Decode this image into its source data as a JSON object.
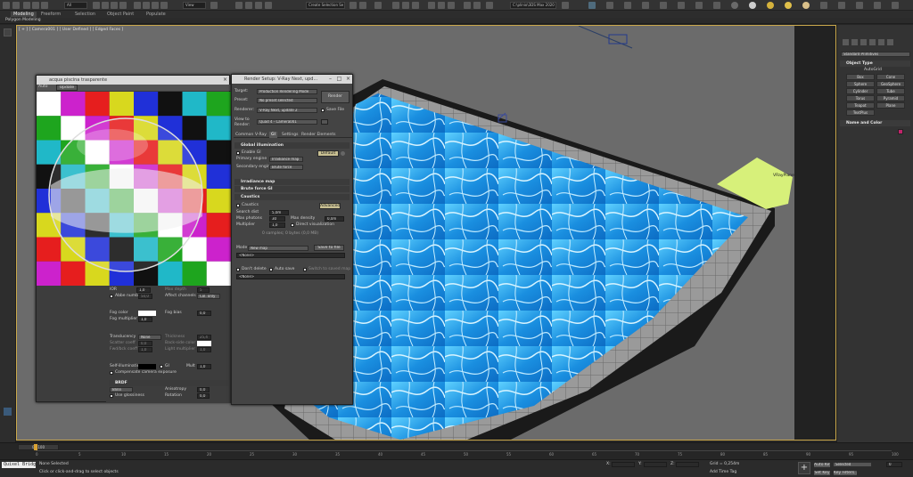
{
  "toolbar": {
    "selection_filter": "All",
    "view_dropdown": "View",
    "create_selection_set": "Create Selection Se",
    "workspace_path": "C:\\plinio\\3DS Max 2020"
  },
  "ribbon": {
    "tabs": [
      "Modeling",
      "Freeform",
      "Selection",
      "Object Paint",
      "Populate"
    ],
    "sub_label": "Polygon Modeling"
  },
  "viewport": {
    "label": "[ + ] [ Camera001 ] [ User Defined ] [ Edged Faces ]",
    "object_label": "VRayPlane"
  },
  "material_window": {
    "title": "acqua piscina trasparente",
    "auto_label": "Auto",
    "update_label": "Update",
    "ior_label": "IOR",
    "ior_value": "1,0",
    "max_depth_label": "Max depth",
    "max_depth_value": "5",
    "abbe_label": "Abbe number",
    "abbe_value": "50,0",
    "affect_channels_label": "Affect channels",
    "affect_channels_value": "Col. only",
    "fog_color_label": "Fog color",
    "fog_bias_label": "Fog bias",
    "fog_bias_value": "0,0",
    "fog_multiplier_label": "Fog multiplier",
    "fog_multiplier_value": "1,0",
    "translucency_label": "Translucency",
    "translucency_value": "None",
    "thickness_label": "Thickness",
    "thickness_value": "25,4",
    "back_side_color_label": "Back-side color",
    "scatter_coeff_label": "Scatter coeff",
    "scatter_coeff_value": "0,0",
    "fwd_bwd_coeff_label": "Fwd/bck coeff",
    "fwd_bwd_coeff_value": "1,0",
    "light_multiplier_label": "Light multiplier",
    "light_multiplier_value": "1,0",
    "self_illum_label": "Self-illumination",
    "gi_label": "GI",
    "mult_label": "Mult",
    "mult_value": "1,0",
    "compensate_label": "Compensate camera exposure",
    "brdf_label": "BRDF",
    "brdf_type": "Blinn",
    "anisotropy_label": "Anisotropy",
    "anisotropy_value": "0,0",
    "use_glossiness_label": "Use glossiness",
    "rotation_label": "Rotation",
    "rotation_value": "0,0"
  },
  "render_setup": {
    "title": "Render Setup: V-Ray Next, upd...",
    "target_label": "Target:",
    "target_value": "Production Rendering Mode",
    "preset_label": "Preset:",
    "preset_value": "No preset selected",
    "renderer_label": "Renderer:",
    "renderer_value": "V-Ray Next, update 2",
    "save_file_label": "Save File",
    "view_label": "View to Render:",
    "view_value": "Quad 4 - Camera001",
    "render_button": "Render",
    "tabs": [
      "Common",
      "V-Ray",
      "GI",
      "Settings",
      "Render Elements"
    ],
    "active_tab": "GI",
    "gi_rollout": "Global illumination",
    "enable_gi_label": "Enable GI",
    "default_button": "Default",
    "primary_engine_label": "Primary engine",
    "primary_engine_value": "Irradiance map",
    "secondary_engine_label": "Secondary engine",
    "secondary_engine_value": "Brute force",
    "irradiance_rollout": "Irradiance map",
    "brute_force_rollout": "Brute force GI",
    "caustics_rollout": "Caustics",
    "caustics_label": "Caustics",
    "advanced_button": "Advanced",
    "search_dist_label": "Search dist",
    "search_dist_value": "5,0m",
    "max_photons_label": "Max photons",
    "max_photons_value": "30",
    "max_density_label": "Max density",
    "max_density_value": "0,0m",
    "multiplier_label": "Multiplier",
    "multiplier_value": "1,0",
    "direct_vis_label": "Direct visualization",
    "info_text": "0 samples; 0 bytes (0,0 MB)",
    "mode_label": "Mode",
    "mode_value": "New map",
    "save_to_file": "Save to file",
    "none_label": "<None>",
    "dont_delete_label": "Don't delete",
    "auto_save_label": "Auto save",
    "switch_label": "Switch to saved map",
    "none_label2": "<None>"
  },
  "command_panel": {
    "category": "Standard Primitives",
    "object_type_header": "Object Type",
    "autogrid": "AutoGrid",
    "buttons": [
      "Box",
      "Cone",
      "Sphere",
      "GeoSphere",
      "Cylinder",
      "Tube",
      "Torus",
      "Pyramid",
      "Teapot",
      "Plane",
      "TextPlus"
    ],
    "name_color_header": "Name and Color",
    "swatch_color": "#c0246a"
  },
  "timeline": {
    "frame_label": "0 / 100",
    "ticks": [
      "0",
      "5",
      "10",
      "15",
      "20",
      "25",
      "30",
      "35",
      "40",
      "45",
      "50",
      "55",
      "60",
      "65",
      "70",
      "75",
      "80",
      "85",
      "90",
      "95",
      "100"
    ]
  },
  "status": {
    "script_label": "Quixel Bridg",
    "selected_text": "None Selected",
    "prompt_text": "Click or click-and-drag to select objects",
    "x_label": "X:",
    "y_label": "Y:",
    "z_label": "Z:",
    "grid_text": "Grid = 0,254m",
    "add_time_tag": "Add Time Tag",
    "auto_key": "Auto Key",
    "set_key": "Set Key",
    "selected_dropdown": "Selected",
    "key_filters": "Key Filters...",
    "frame_value": "0"
  }
}
